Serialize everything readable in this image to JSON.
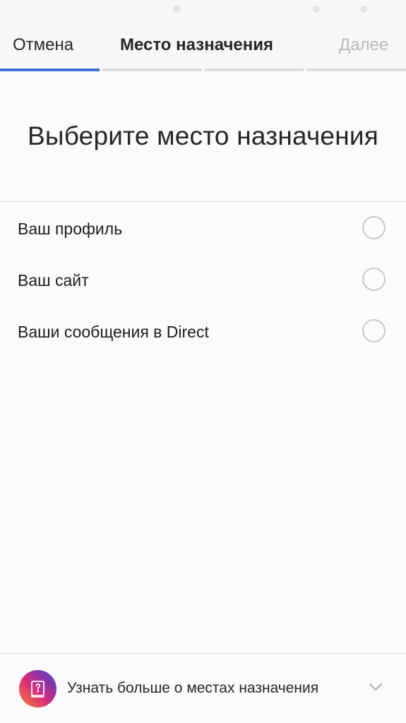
{
  "nav": {
    "cancel_label": "Отмена",
    "title": "Место назначения",
    "next_label": "Далее"
  },
  "progress": {
    "total_steps": 4,
    "current_step": 1
  },
  "heading": "Выберите место назначения",
  "options": [
    {
      "label": "Ваш профиль",
      "selected": false
    },
    {
      "label": "Ваш сайт",
      "selected": false
    },
    {
      "label": "Ваши сообщения в Direct",
      "selected": false
    }
  ],
  "footer": {
    "label": "Узнать больше о местах назначения",
    "icon": "question-book-icon",
    "chevron_icon": "chevron-down-icon"
  },
  "colors": {
    "accent": "#3a6fd8",
    "text": "#262626",
    "disabled": "#b8b8bd",
    "radio_border": "#c7c7cc"
  }
}
